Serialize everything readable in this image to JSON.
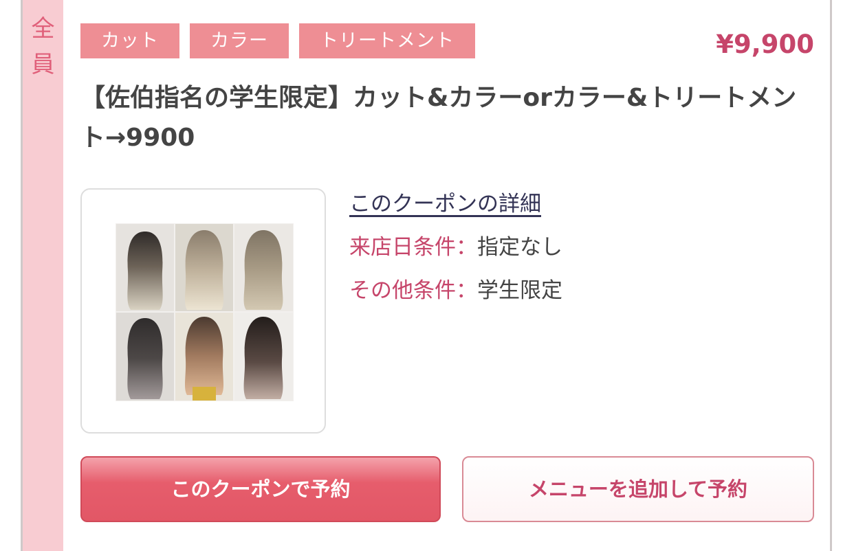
{
  "audience": {
    "label_chars": [
      "全",
      "員"
    ]
  },
  "tags": [
    "カット",
    "カラー",
    "トリートメント"
  ],
  "price": "¥9,900",
  "title": "【佐伯指名の学生限定】カット&カラーorカラー&トリートメント→9900",
  "thumbnail": {
    "alt": "hair-color-style-collage"
  },
  "coupon_detail_link": "このクーポンの詳細",
  "conditions": [
    {
      "key": "来店日条件：",
      "value": "指定なし"
    },
    {
      "key": "その他条件：",
      "value": "学生限定"
    }
  ],
  "buttons": {
    "reserve": "このクーポンで予約",
    "add_menu_reserve": "メニューを追加して予約"
  },
  "colors": {
    "accent": "#c6456a",
    "tag_bg": "#ee8e94",
    "strip_bg": "#f8ccd2",
    "primary_button": "#e65d6c"
  }
}
